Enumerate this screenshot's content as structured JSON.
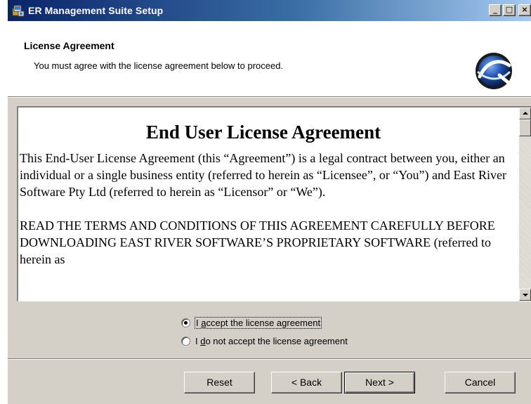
{
  "window": {
    "title": "ER Management Suite Setup",
    "controls": {
      "minimize": "_",
      "maximize": "□",
      "close": "×"
    }
  },
  "header": {
    "title": "License Agreement",
    "subtitle": "You must agree with the license agreement below to proceed.",
    "logo_icon": "installer-globe-logo-icon"
  },
  "license": {
    "title": "End User License Agreement",
    "paragraph1": "This End-User License Agreement (this “Agreement”) is a legal contract between you,  either an individual or a single business entity (referred to herein as “Licensee”, or “You”) and East River Software Pty Ltd (referred to herein as “Licensor” or “We”).",
    "paragraph2": "READ THE TERMS AND CONDITIONS OF THIS AGREEMENT CAREFULLY BEFORE DOWNLOADING EAST RIVER SOFTWARE’S PROPRIETARY SOFTWARE (referred to herein as"
  },
  "options": {
    "accept": {
      "prefix": "I ",
      "mnemonic": "a",
      "rest": "ccept the license agreement",
      "selected": true
    },
    "decline": {
      "prefix": "I ",
      "mnemonic": "d",
      "rest": "o not accept the license agreement",
      "selected": false
    }
  },
  "buttons": {
    "reset": "Reset",
    "back": "< Back",
    "next": "Next >",
    "cancel": "Cancel"
  },
  "colors": {
    "titlebar_start": "#0a246a",
    "titlebar_end": "#a6caf0",
    "dialog_bg": "#d4d0c8"
  }
}
